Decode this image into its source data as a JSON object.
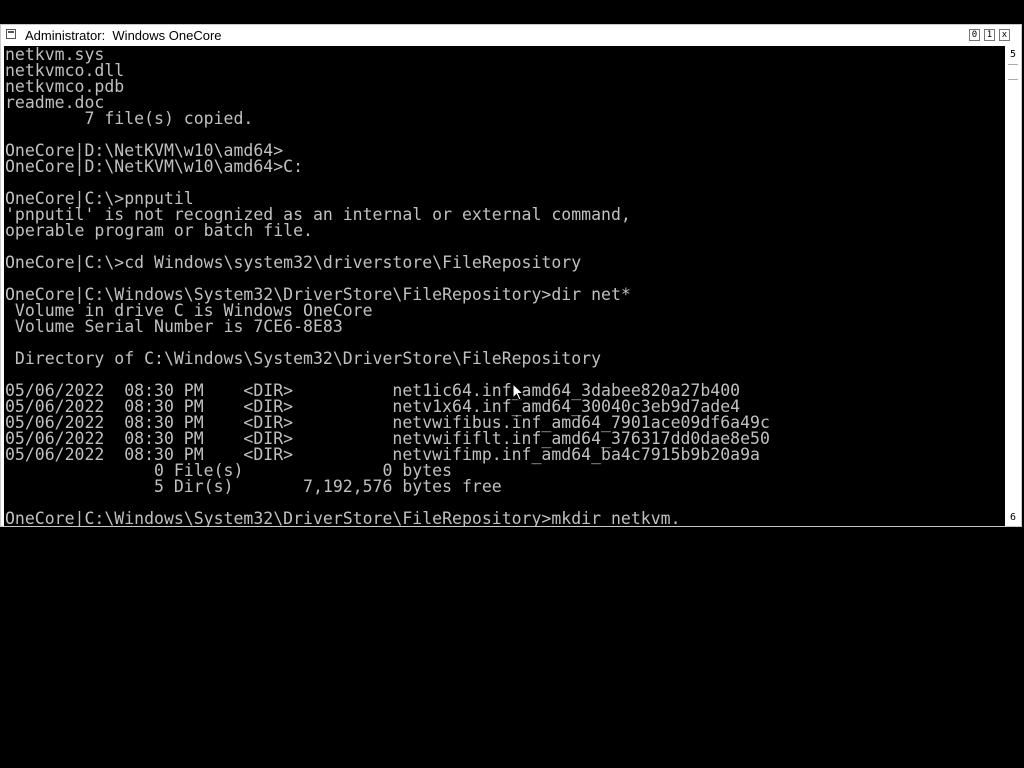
{
  "window": {
    "title": "Administrator:  Windows OneCore",
    "controls": {
      "minimize": "0",
      "maximize": "1",
      "close": "x"
    }
  },
  "console": {
    "lines": [
      "netkvm.sys",
      "netkvmco.dll",
      "netkvmco.pdb",
      "readme.doc",
      "        7 file(s) copied.",
      "",
      "OneCore|D:\\NetKVM\\w10\\amd64>",
      "OneCore|D:\\NetKVM\\w10\\amd64>C:",
      "",
      "OneCore|C:\\>pnputil",
      "'pnputil' is not recognized as an internal or external command,",
      "operable program or batch file.",
      "",
      "OneCore|C:\\>cd Windows\\system32\\driverstore\\FileRepository",
      "",
      "OneCore|C:\\Windows\\System32\\DriverStore\\FileRepository>dir net*",
      " Volume in drive C is Windows OneCore",
      " Volume Serial Number is 7CE6-8E83",
      "",
      " Directory of C:\\Windows\\System32\\DriverStore\\FileRepository",
      "",
      "05/06/2022  08:30 PM    <DIR>          net1ic64.inf_amd64_3dabee820a27b400",
      "05/06/2022  08:30 PM    <DIR>          netv1x64.inf_amd64_30040c3eb9d7ade4",
      "05/06/2022  08:30 PM    <DIR>          netvwifibus.inf_amd64_7901ace09df6a49c",
      "05/06/2022  08:30 PM    <DIR>          netvwififlt.inf_amd64_376317dd0dae8e50",
      "05/06/2022  08:30 PM    <DIR>          netvwifimp.inf_amd64_ba4c7915b9b20a9a",
      "               0 File(s)              0 bytes",
      "               5 Dir(s)       7,192,576 bytes free",
      "",
      "OneCore|C:\\Windows\\System32\\DriverStore\\FileRepository>mkdir netkvm."
    ]
  },
  "scrollbar": {
    "top_label": "5",
    "bottom_label": "6"
  },
  "colors": {
    "console_bg": "#000000",
    "console_text": "#c0c0c0",
    "frame": "#ffffff"
  },
  "icons": {
    "system_menu": "console-window-icon",
    "pointer": "mouse-pointer-icon"
  }
}
